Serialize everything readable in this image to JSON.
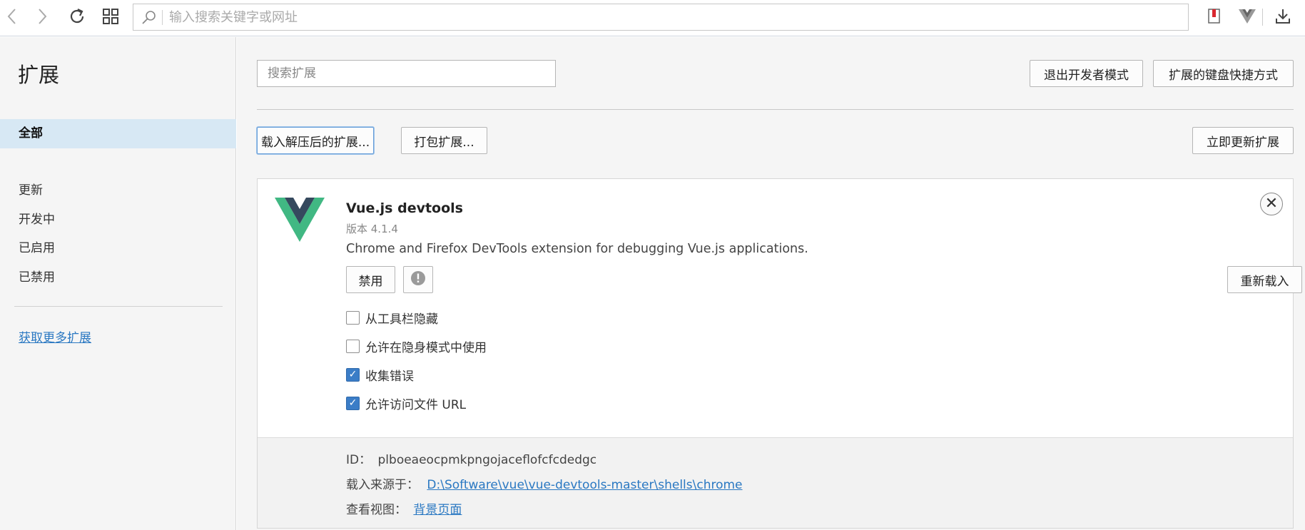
{
  "browser": {
    "address_placeholder": "输入搜索关键字或网址"
  },
  "sidebar": {
    "title": "扩展",
    "items": [
      {
        "label": "全部"
      },
      {
        "label": "更新"
      },
      {
        "label": "开发中"
      },
      {
        "label": "已启用"
      },
      {
        "label": "已禁用"
      }
    ],
    "more_link": "获取更多扩展"
  },
  "main": {
    "search_placeholder": "搜索扩展",
    "exit_dev_mode": "退出开发者模式",
    "keyboard_shortcuts": "扩展的键盘快捷方式",
    "load_unpacked": "载入解压后的扩展...",
    "pack_extension": "打包扩展...",
    "update_now": "立即更新扩展"
  },
  "extension": {
    "name": "Vue.js devtools",
    "version": "版本 4.1.4",
    "description": "Chrome and Firefox DevTools extension for debugging Vue.js applications.",
    "disable_label": "禁用",
    "reload_label": "重新载入",
    "options": [
      {
        "label": "从工具栏隐藏",
        "checked": false
      },
      {
        "label": "允许在隐身模式中使用",
        "checked": false
      },
      {
        "label": "收集错误",
        "checked": true
      },
      {
        "label": "允许访问文件 URL",
        "checked": true
      }
    ],
    "id_label": "ID：",
    "id_value": "plboeaeocpmkpngojaceflofcfcdedgc",
    "source_label": "载入来源于：",
    "source_value": "D:\\Software\\vue\\vue-devtools-master\\shells\\chrome",
    "views_label": "查看视图：",
    "views_value": "背景页面",
    "logo_colors": {
      "outer": "#41b883",
      "inner": "#35495e"
    }
  }
}
